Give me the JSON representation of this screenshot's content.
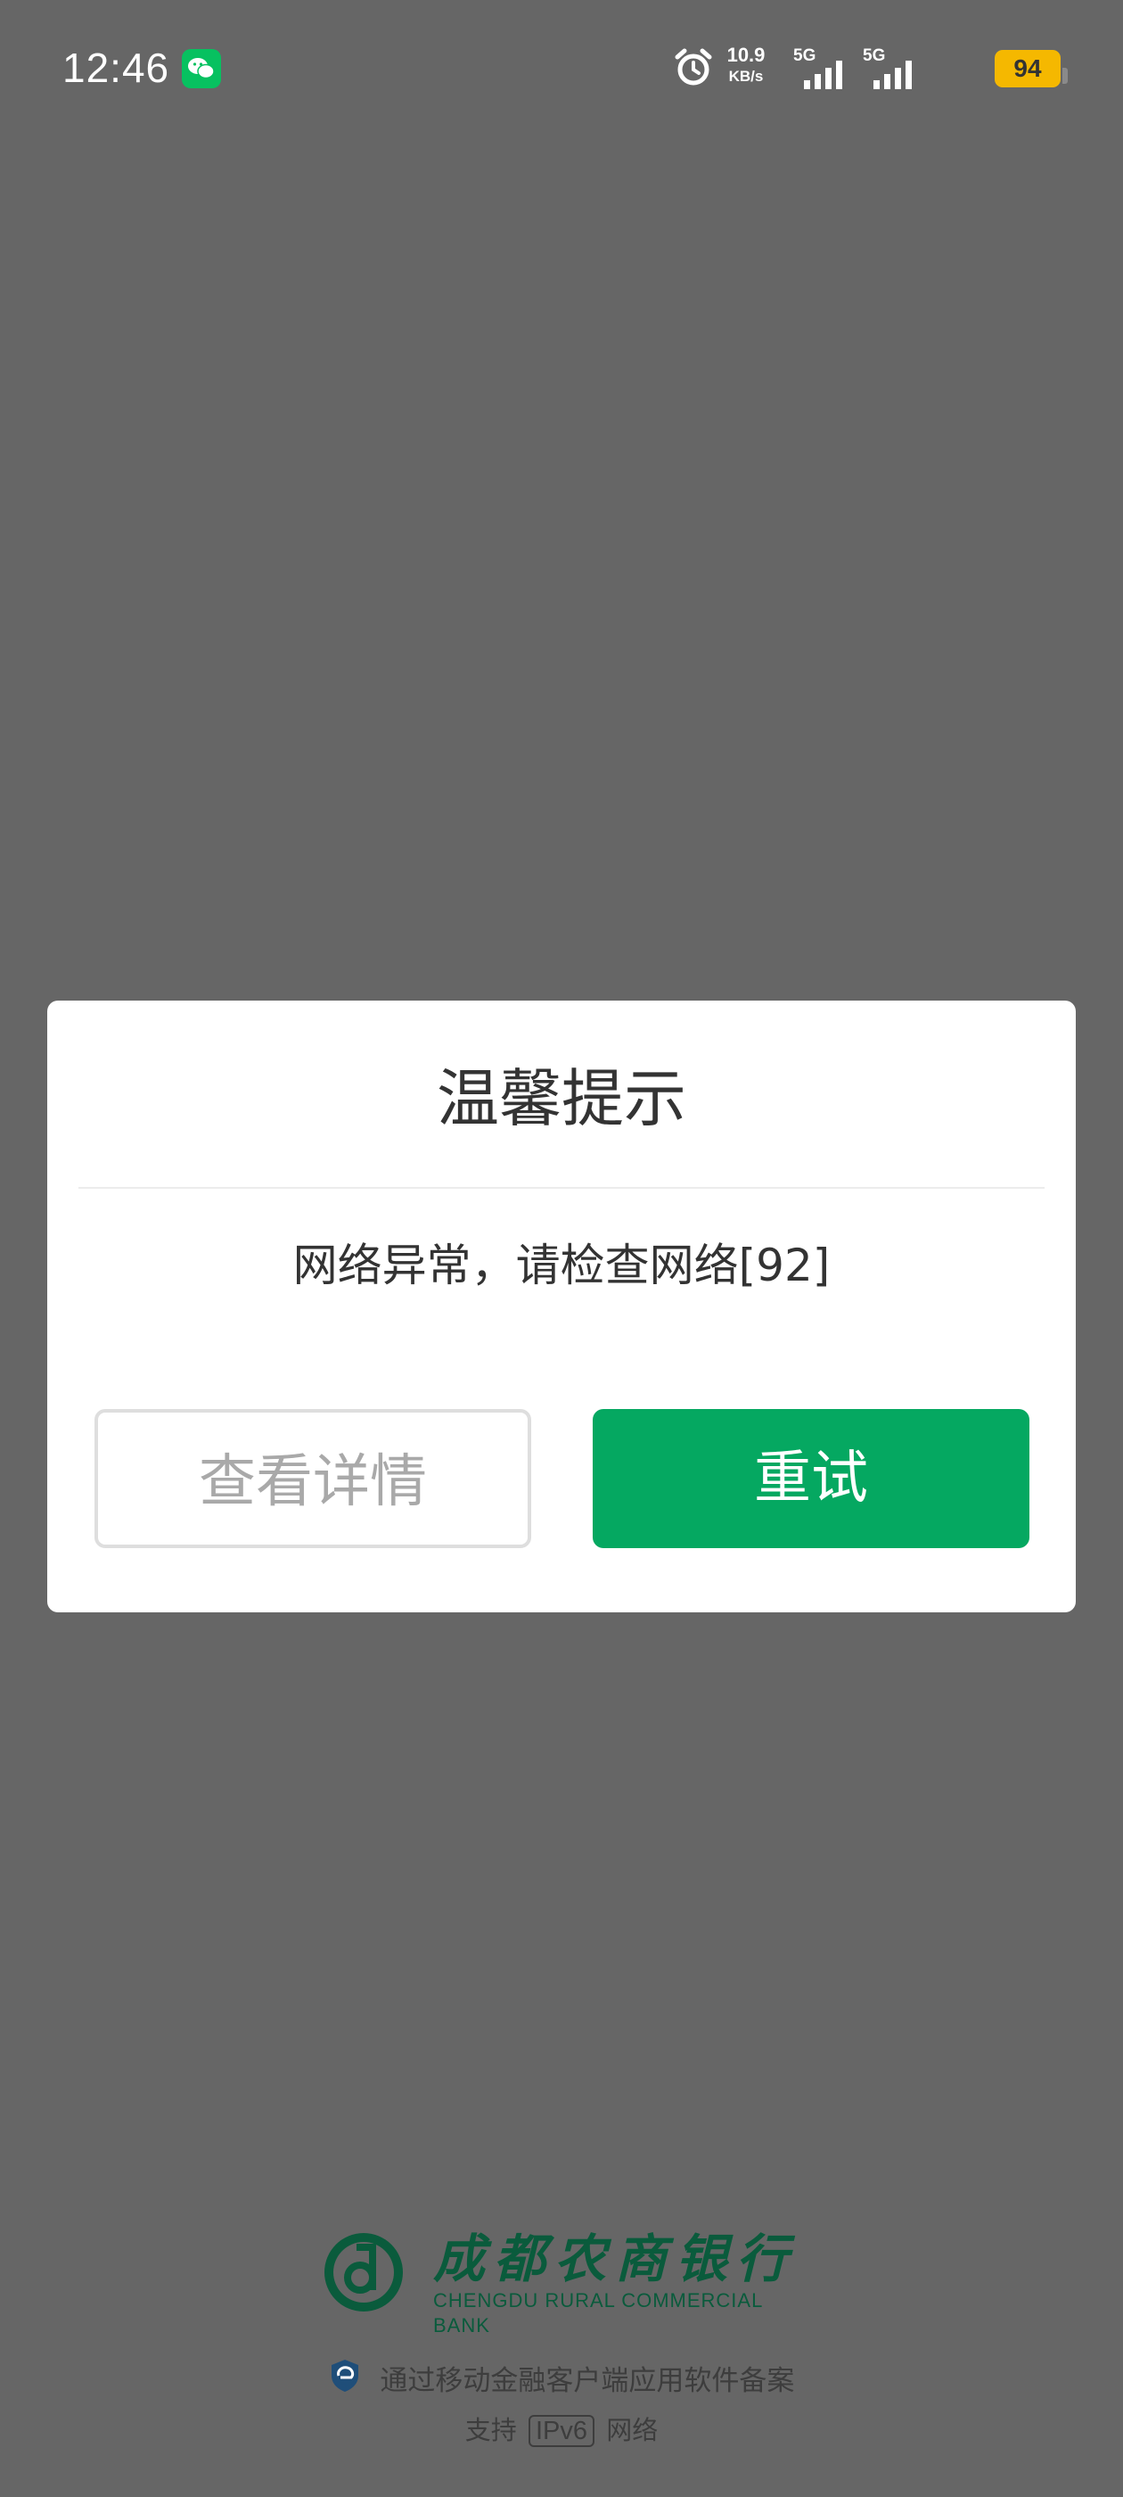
{
  "status_bar": {
    "time": "12:46",
    "net_speed_value": "10.9",
    "net_speed_unit": "KB/s",
    "sim1_label": "5G",
    "sim2_label": "5G",
    "battery": "94",
    "battery_color": "#f5b800"
  },
  "dialog": {
    "title": "温馨提示",
    "message": "网络异常，请检查网络[92]",
    "details_button": "查看详情",
    "retry_button": "重试",
    "retry_color": "#05a861"
  },
  "footer": {
    "bank_name_cn": "成都农商银行",
    "bank_name_en": "CHENGDU RURAL COMMERCIAL BANK",
    "filing_text": "通过移动金融客户端应用软件备案",
    "ipv6_prefix": "支持",
    "ipv6_badge": "IPv6",
    "ipv6_suffix": "网络"
  },
  "icons": [
    "wechat-icon",
    "alarm-icon",
    "signal-icon",
    "battery-icon",
    "bank-logo-icon",
    "shield-icon"
  ]
}
